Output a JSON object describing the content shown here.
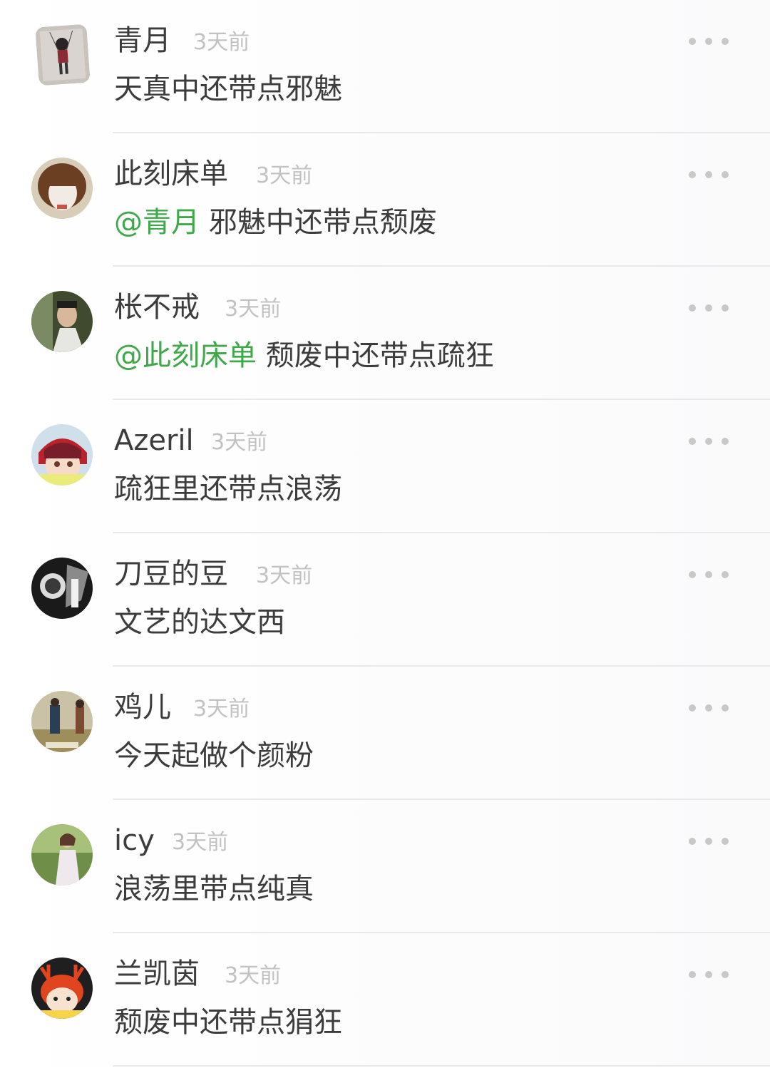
{
  "comments": [
    {
      "user": "青月",
      "time": "3天前",
      "mention": "",
      "text": "天真中还带点邪魅"
    },
    {
      "user": "此刻床单",
      "time": "3天前",
      "mention": "@青月",
      "text": "邪魅中还带点颓废"
    },
    {
      "user": "枨不戒",
      "time": "3天前",
      "mention": "@此刻床单",
      "text": "颓废中还带点疏狂"
    },
    {
      "user": "Azeril",
      "time": "3天前",
      "mention": "",
      "text": "疏狂里还带点浪荡"
    },
    {
      "user": "刀豆的豆",
      "time": "3天前",
      "mention": "",
      "text": "文艺的达文西"
    },
    {
      "user": "鸡儿",
      "time": "3天前",
      "mention": "",
      "text": "今天起做个颜粉"
    },
    {
      "user": "icy",
      "time": "3天前",
      "mention": "",
      "text": "浪荡里带点纯真"
    },
    {
      "user": "兰凯茵",
      "time": "3天前",
      "mention": "",
      "text": "颓废中还带点狷狂"
    }
  ],
  "more_icon": "more-dots-icon",
  "colors": {
    "mention": "#3fa94a",
    "username": "#3c3c3c",
    "timestamp": "#c2c2c2",
    "divider": "#e9e9ec"
  }
}
